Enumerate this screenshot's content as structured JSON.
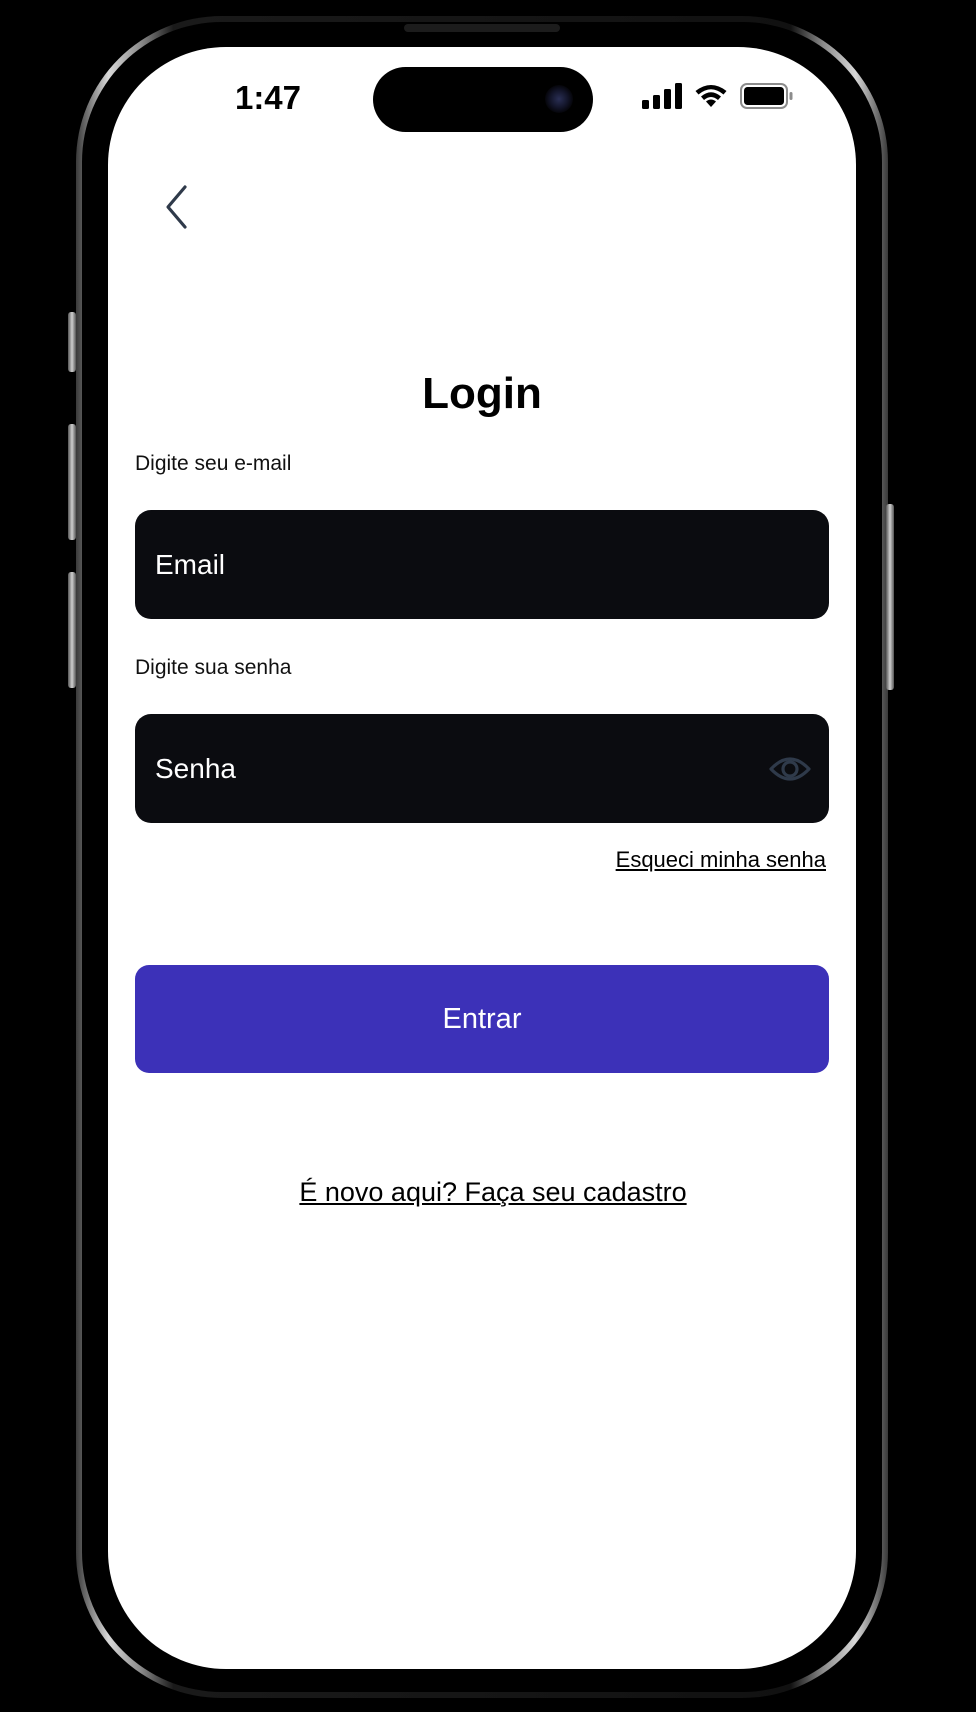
{
  "status_bar": {
    "time": "1:47",
    "icons": [
      "signal-icon",
      "wifi-icon",
      "battery-icon"
    ]
  },
  "header": {
    "back_icon": "chevron-left-icon"
  },
  "login": {
    "title": "Login",
    "email_label": "Digite seu e-mail",
    "email_placeholder": "Email",
    "password_label": "Digite sua senha",
    "password_placeholder": "Senha",
    "password_toggle_icon": "eye-icon",
    "forgot_password": "Esqueci minha senha",
    "submit_label": "Entrar",
    "signup_link": "É novo aqui? Faça seu cadastro"
  },
  "colors": {
    "primary_button": "#3c31b8",
    "input_background": "#0b0c10",
    "screen_background": "#ffffff",
    "icon_gray": "#2f3a4a"
  }
}
